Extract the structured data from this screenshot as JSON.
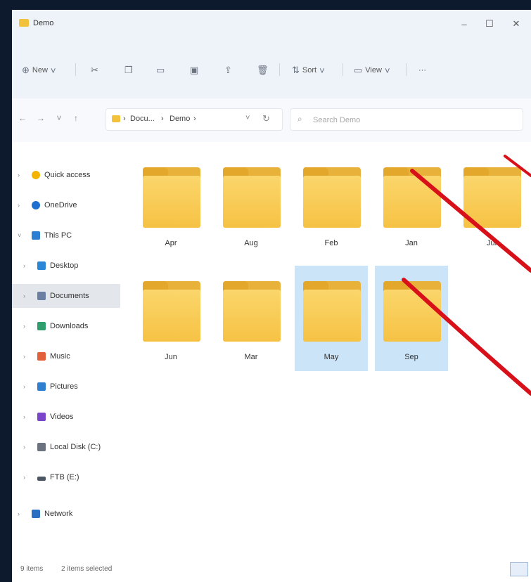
{
  "window": {
    "title": "Demo"
  },
  "window_controls": {
    "minimize": "–",
    "maximize": "☐",
    "close": "✕"
  },
  "toolbar": {
    "new_label": "New",
    "sort_label": "Sort",
    "view_label": "View",
    "more_label": "···"
  },
  "address": {
    "crumbs": [
      "Docu...",
      "Demo"
    ],
    "separator": "›"
  },
  "search": {
    "placeholder": "Search Demo"
  },
  "sidebar": {
    "items": [
      {
        "label": "Quick access",
        "icon": "star-icon",
        "color": "#f2b400"
      },
      {
        "label": "OneDrive",
        "icon": "cloud-icon",
        "color": "#1e6fd0"
      },
      {
        "label": "This PC",
        "icon": "pc-icon",
        "color": "#2d7fd1"
      },
      {
        "label": "Desktop",
        "icon": "desktop-icon",
        "color": "#2a86d6"
      },
      {
        "label": "Documents",
        "icon": "documents-icon",
        "color": "#6b7fa3"
      },
      {
        "label": "Downloads",
        "icon": "downloads-icon",
        "color": "#2e9e6d"
      },
      {
        "label": "Music",
        "icon": "music-icon",
        "color": "#e2613a"
      },
      {
        "label": "Pictures",
        "icon": "pictures-icon",
        "color": "#2f7fd0"
      },
      {
        "label": "Videos",
        "icon": "videos-icon",
        "color": "#7b45c9"
      },
      {
        "label": "Local Disk (C:)",
        "icon": "disk-icon",
        "color": "#6b7280"
      },
      {
        "label": "FTB (E:)",
        "icon": "drive-icon",
        "color": "#4b5563"
      },
      {
        "label": "Network",
        "icon": "network-icon",
        "color": "#2a6fc2"
      }
    ],
    "selected_index": 4
  },
  "folders": [
    {
      "label": "Apr",
      "selected": false
    },
    {
      "label": "Aug",
      "selected": false
    },
    {
      "label": "Feb",
      "selected": false
    },
    {
      "label": "Jan",
      "selected": false
    },
    {
      "label": "Jul",
      "selected": false
    },
    {
      "label": "Jun",
      "selected": false
    },
    {
      "label": "Mar",
      "selected": false
    },
    {
      "label": "May",
      "selected": true
    },
    {
      "label": "Sep",
      "selected": true
    }
  ],
  "status": {
    "count": "9 items",
    "selection": "2 items selected"
  },
  "colors": {
    "arrow": "#d8101a",
    "selection": "#cce4f7",
    "folder": "#f6c244"
  }
}
